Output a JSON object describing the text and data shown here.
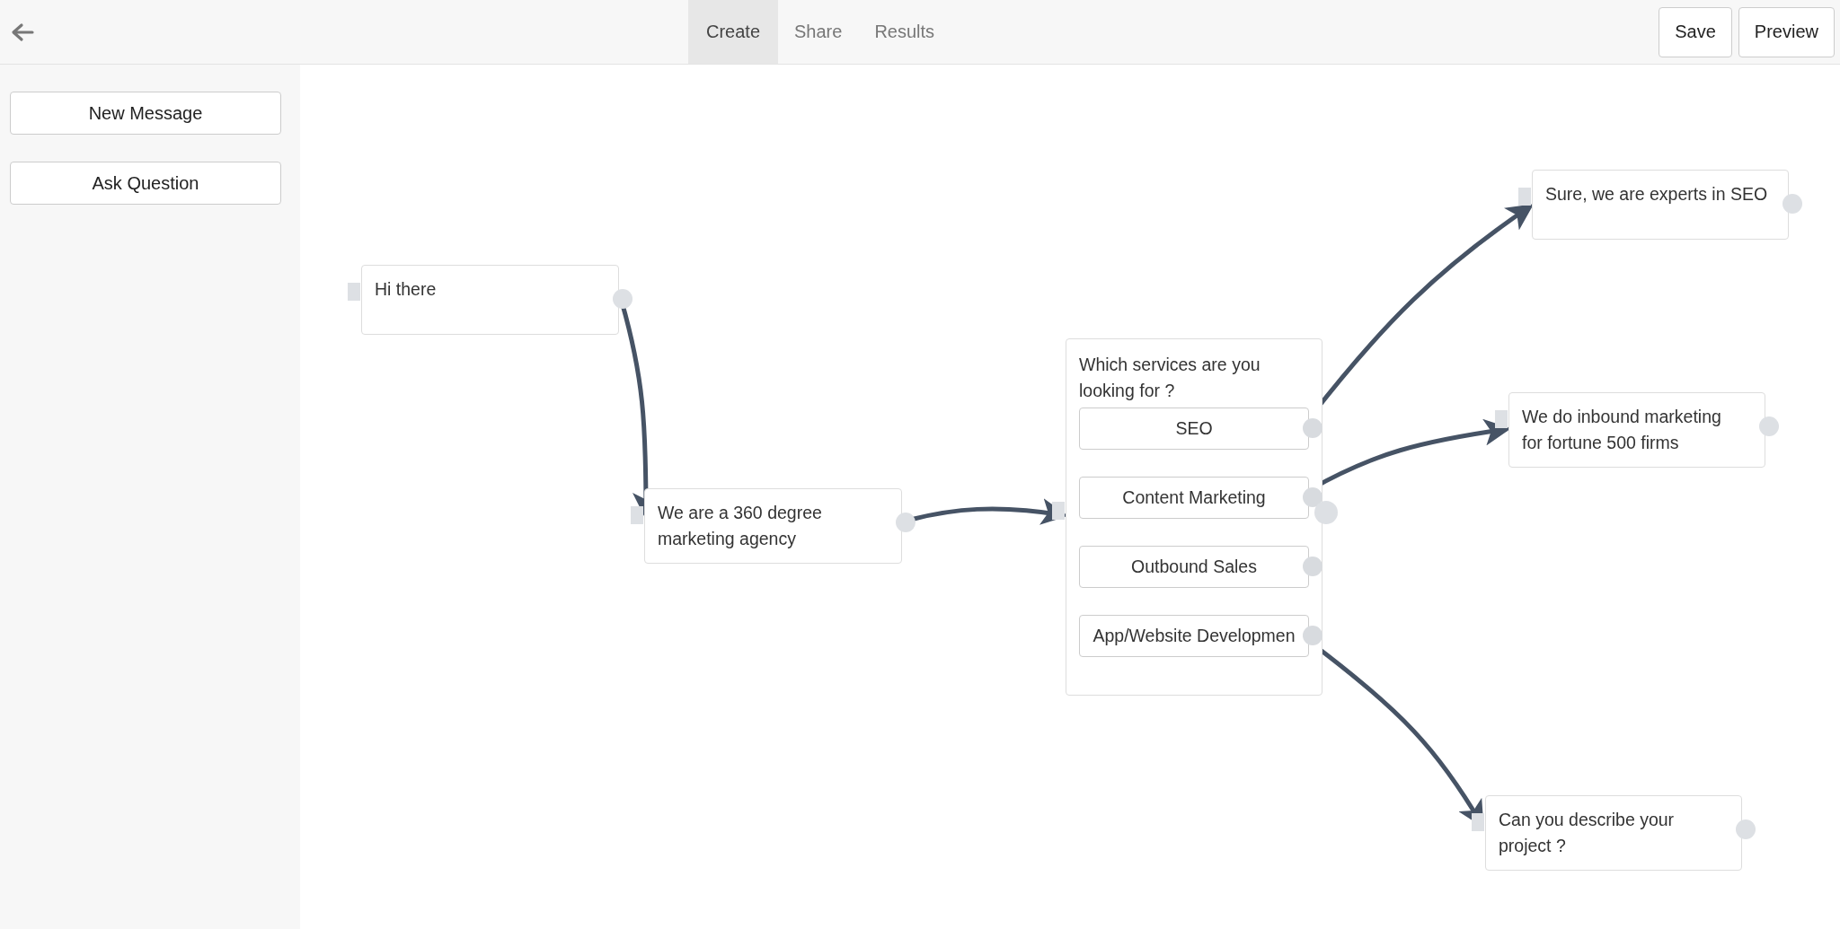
{
  "top_bar": {
    "tabs": [
      {
        "label": "Create",
        "selected": true
      },
      {
        "label": "Share",
        "selected": false
      },
      {
        "label": "Results",
        "selected": false
      }
    ],
    "buttons": [
      "Save",
      "Preview"
    ]
  },
  "sidebar": {
    "buttons": [
      "New Message",
      "Ask Question"
    ]
  },
  "nodes": [
    {
      "kind": "message",
      "text": "Hi there"
    },
    {
      "kind": "message",
      "text": "We are a 360 degree marketing agency"
    },
    {
      "kind": "question",
      "text": "Which services are you looking for ?",
      "options": [
        "SEO",
        "Content Marketing",
        "Outbound Sales",
        "App/Website Developmen"
      ]
    },
    {
      "kind": "message",
      "text": "Sure, we are experts in SEO"
    },
    {
      "kind": "message",
      "text": "We do inbound marketing for fortune 500 firms"
    },
    {
      "kind": "message",
      "text": "Can you describe your project ?"
    }
  ]
}
